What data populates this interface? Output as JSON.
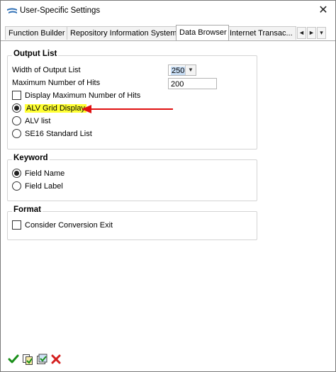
{
  "window": {
    "title": "User-Specific Settings",
    "close_label": "✕"
  },
  "tabs": [
    {
      "label": "Function Builder"
    },
    {
      "label": "Repository Information System"
    },
    {
      "label": "Data Browser"
    },
    {
      "label": "Internet Transac..."
    }
  ],
  "tab_nav": {
    "left": "◄",
    "right": "►",
    "menu": "▾"
  },
  "output_list": {
    "title": "Output List",
    "width_label": "Width of Output List",
    "width_value": "250",
    "max_hits_label": "Maximum Number of Hits",
    "max_hits_value": "200",
    "display_max_label": "Display Maximum Number of Hits",
    "option_alv_grid": "ALV Grid Display",
    "option_alv_list": "ALV list",
    "option_se16": "SE16 Standard List",
    "selected_option": "ALV Grid Display"
  },
  "keyword": {
    "title": "Keyword",
    "option_field_name": "Field Name",
    "option_field_label": "Field Label",
    "selected_option": "Field Name"
  },
  "format": {
    "title": "Format",
    "consider_conversion_label": "Consider Conversion Exit"
  },
  "colors": {
    "highlight": "#ffff33",
    "annotation_arrow": "#e01010",
    "confirm_icon": "#1a8f1a",
    "cancel_icon": "#d42020"
  },
  "toolbar": {
    "icons": [
      "checkmark-icon",
      "copy-settings-icon",
      "save-settings-icon",
      "cancel-icon"
    ]
  }
}
